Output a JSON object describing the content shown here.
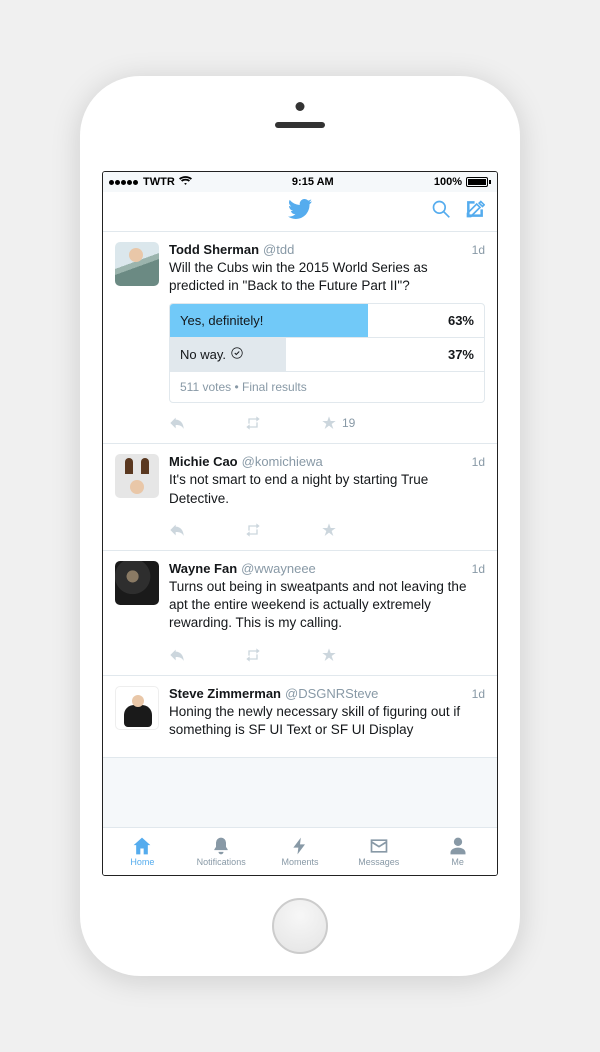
{
  "status": {
    "carrier": "TWTR",
    "time": "9:15 AM",
    "battery": "100%"
  },
  "navbar": {
    "title": "twitter-logo"
  },
  "tweets": [
    {
      "author": "Todd Sherman",
      "handle": "@tdd",
      "time": "1d",
      "text": "Will the Cubs win the 2015 World Series as predicted in \"Back to the Future Part II\"?",
      "poll": {
        "options": [
          {
            "label": "Yes, definitely!",
            "pct": "63%",
            "width": 63,
            "winner": true
          },
          {
            "label": "No way.",
            "pct": "37%",
            "width": 37,
            "choice": true
          }
        ],
        "meta": "511 votes • Final results"
      },
      "like_count": "19"
    },
    {
      "author": "Michie Cao",
      "handle": "@komichiewa",
      "time": "1d",
      "text": "It's not smart to end a night by starting True Detective."
    },
    {
      "author": "Wayne Fan",
      "handle": "@wwayneee",
      "time": "1d",
      "text": "Turns out being in sweatpants and not leaving the apt the entire weekend is actually extremely rewarding. This is my calling."
    },
    {
      "author": "Steve Zimmerman",
      "handle": "@DSGNRSteve",
      "time": "1d",
      "text": "Honing the newly necessary skill of figuring out if something is SF UI Text or SF UI Display"
    }
  ],
  "tabs": [
    {
      "label": "Home"
    },
    {
      "label": "Notifications"
    },
    {
      "label": "Moments"
    },
    {
      "label": "Messages"
    },
    {
      "label": "Me"
    }
  ]
}
